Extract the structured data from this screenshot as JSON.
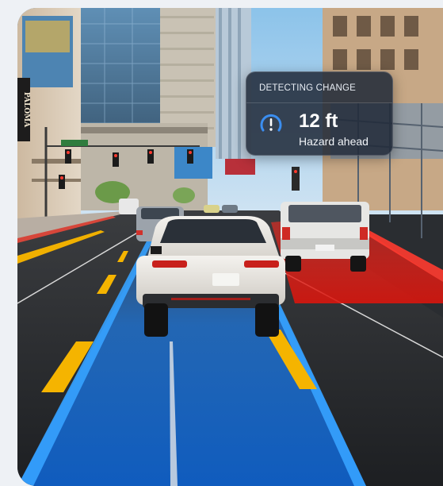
{
  "hud": {
    "title": "DETECTING CHANGE",
    "distance": "12 ft",
    "status": "Hazard ahead",
    "icon": "alert-gauge-icon"
  },
  "signs": {
    "building_sign": "PALOMA"
  },
  "colors": {
    "ego_lane": "#1f7fe6",
    "hazard_zone": "#e0241c",
    "hud_background": "#202938",
    "lane_marking": "#f5b400"
  }
}
